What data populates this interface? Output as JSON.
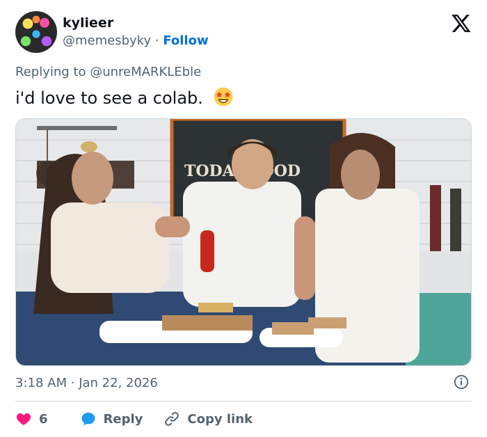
{
  "author": {
    "name": "kylieer",
    "handle": "@memesbyky",
    "separator": "·",
    "follow_label": "Follow"
  },
  "replying": {
    "prefix": "Replying to",
    "target": "@unreMARKLEble"
  },
  "tweet": {
    "text": "i'd love to see a colab.",
    "emoji": "star-struck-emoji"
  },
  "media": {
    "sign_text": "TODAY FOOD"
  },
  "meta": {
    "time": "3:18 AM",
    "dot": "·",
    "date": "Jan 22, 2026"
  },
  "actions": {
    "likes": "6",
    "reply_label": "Reply",
    "copy_label": "Copy link"
  },
  "colors": {
    "follow": "#006fd6",
    "heart": "#f91880",
    "reply_bubble": "#1d9bf0",
    "muted": "#536471"
  }
}
